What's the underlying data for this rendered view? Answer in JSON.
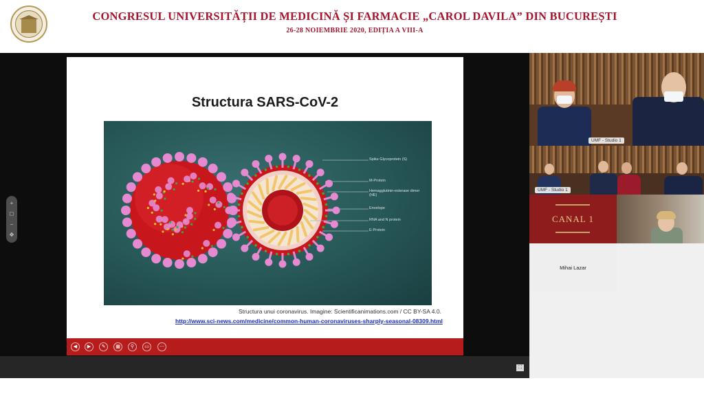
{
  "header": {
    "title": "CONGRESUL UNIVERSITĂȚII DE MEDICINĂ ȘI FARMACIE „CAROL DAVILA” DIN BUCUREȘTI",
    "subtitle": "26-28 NOIEMBRIE 2020, EDIȚIA A VIII-A",
    "logo_icon": "university-seal-icon"
  },
  "slide": {
    "title": "Structura SARS-CoV-2",
    "labels": [
      "Spike Glycoprotein (S)",
      "M-Protein",
      "Hemagglutinin-esterase dimer (HE)",
      "Envelope",
      "RNA and N protein",
      "E-Protein"
    ],
    "caption": "Structura unui coronavirus. Imagine: Scientificanimations.com / CC BY-SA 4.0.",
    "link": "http://www.sci-news.com/medicine/common-human-coronaviruses-sharply-seasonal-08309.html"
  },
  "slide_controls": [
    {
      "icon": "previous-icon",
      "glyph": "◀"
    },
    {
      "icon": "next-icon",
      "glyph": "▶"
    },
    {
      "icon": "pen-icon",
      "glyph": "✎"
    },
    {
      "icon": "slides-grid-icon",
      "glyph": "▦"
    },
    {
      "icon": "zoom-icon",
      "glyph": "⚲"
    },
    {
      "icon": "subtitles-icon",
      "glyph": "▭"
    },
    {
      "icon": "more-icon",
      "glyph": "⋯"
    }
  ],
  "participants": {
    "studio1_label": "UMF - Studio 1",
    "studio1b_label": "UMF - Studio 1",
    "canal_text": "CANAL 1",
    "name_label": "Mihai Lazar"
  },
  "colors": {
    "brand_red": "#a7142b",
    "slide_bar": "#b71c1c",
    "virus_body": "#c8161d",
    "spike": "#e58ad0"
  }
}
